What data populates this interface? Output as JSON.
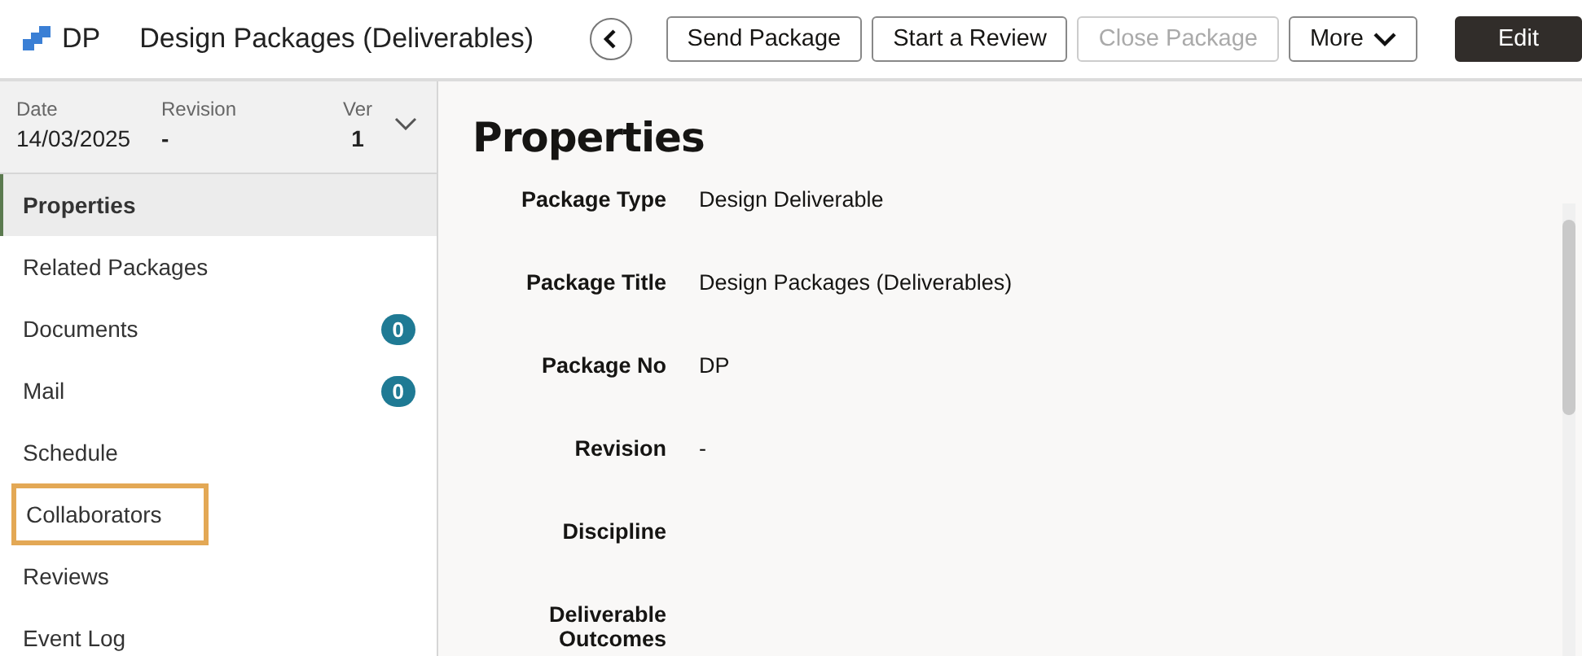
{
  "header": {
    "code": "DP",
    "title": "Design Packages (Deliverables)",
    "buttons": [
      {
        "label": "Send Package",
        "kind": "outline",
        "disabled": false
      },
      {
        "label": "Start a Review",
        "kind": "outline",
        "disabled": false
      },
      {
        "label": "Close Package",
        "kind": "outline",
        "disabled": true
      },
      {
        "label": "More",
        "kind": "menu",
        "disabled": false
      },
      {
        "label": "Edit",
        "kind": "primary",
        "disabled": false
      }
    ]
  },
  "summary": [
    {
      "label": "Date",
      "value": "14/03/2025"
    },
    {
      "label": "Revision",
      "value": "-"
    },
    {
      "label": "Ver",
      "value": "1"
    }
  ],
  "sidebar": {
    "items": [
      {
        "label": "Properties",
        "selected": true,
        "highlighted": false
      },
      {
        "label": "Related Packages",
        "selected": false,
        "highlighted": false
      },
      {
        "label": "Documents",
        "selected": false,
        "highlighted": false,
        "count": "0"
      },
      {
        "label": "Mail",
        "selected": false,
        "highlighted": false,
        "count": "0"
      },
      {
        "label": "Schedule",
        "selected": false,
        "highlighted": false
      },
      {
        "label": "Collaborators",
        "selected": false,
        "highlighted": true
      },
      {
        "label": "Reviews",
        "selected": false,
        "highlighted": false
      },
      {
        "label": "Event Log",
        "selected": false,
        "highlighted": false
      }
    ]
  },
  "properties": {
    "heading": "Properties",
    "fields": [
      {
        "label": "Package Type",
        "value": "Design Deliverable"
      },
      {
        "label": "Package Title",
        "value": "Design Packages (Deliverables)"
      },
      {
        "label": "Package No",
        "value": "DP"
      },
      {
        "label": "Revision",
        "value": "-"
      },
      {
        "label": "Discipline"
      },
      {
        "label": "Deliverable Outcomes"
      }
    ]
  }
}
